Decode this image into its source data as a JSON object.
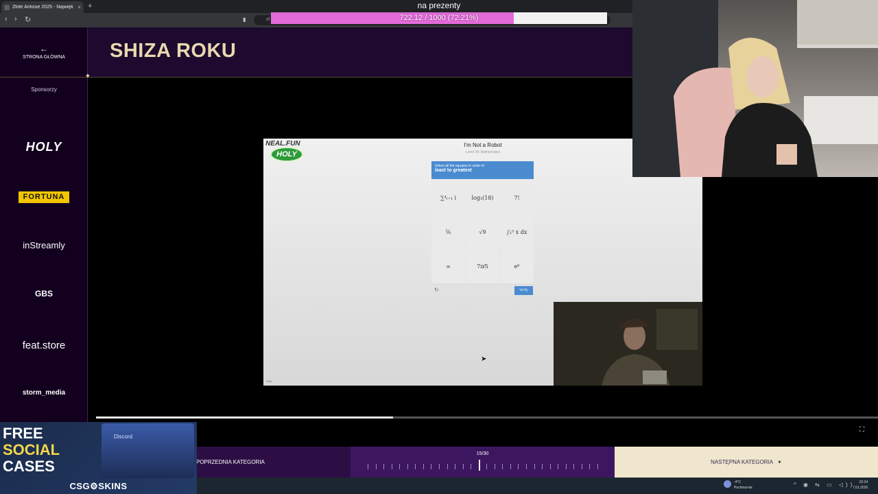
{
  "browser": {
    "tab_title": "Złote Antosie 2025 - Najwięk",
    "tab_close": "×",
    "new_tab": "+",
    "back": "‹",
    "forward": "›",
    "reload": "↻",
    "bookmark": "▮",
    "url": "zl"
  },
  "donation_goal": {
    "title": "na prezenty",
    "text": "722.12 / 1000 (72.21%)",
    "current": 722.12,
    "goal": 1000,
    "percent": 72.21,
    "fill_color": "#e26ad9"
  },
  "sidebar": {
    "back_label": "STRONA GŁÓWNA",
    "back_icon": "←",
    "sponsors_label": "Sponsorzy",
    "sponsors": [
      "HOLY",
      "FORTUNA",
      "inStreamly",
      "GBS",
      "feat.store",
      "storm_media"
    ]
  },
  "header": {
    "title": "SHIZA ROKU"
  },
  "captcha": {
    "site_label": "NEAL.FUN",
    "badge": "HOLY",
    "title": "I'm Not a Robot",
    "level": "Level 34: Mathematics",
    "instruction": "Select all the squares in order of",
    "emphasis": "least to greatest",
    "cells": [
      "∑⁴ᵢ₌₁ i",
      "log₃(18)",
      "7!",
      "⅚",
      "√9",
      "∫₁⁵ x dx",
      "∞",
      "7π⁄5",
      "e⁶"
    ],
    "reload_icon": "↻",
    "verify": "Verify",
    "footer": "Neal"
  },
  "video_progress": 0.38,
  "bottom": {
    "prev": "POPRZEDNIA KATEGORIA",
    "counter": "15/30",
    "current": 15,
    "total": 30,
    "next": "NASTĘPNA KATEGORIA",
    "next_icon": "✦"
  },
  "promo": {
    "line1": "FREE",
    "line2": "SOCIAL",
    "line3": "CASES",
    "discord": "Discord",
    "brand": "CSG⚙SKINS"
  },
  "taskbar": {
    "temperature": "-4°C",
    "weather": "Pochmurnie",
    "time": "02:24",
    "date": "7.01.2026",
    "tray": "^ ◉ ⇆ ▭ ◁))"
  },
  "fullscreen_icon": "⛶"
}
